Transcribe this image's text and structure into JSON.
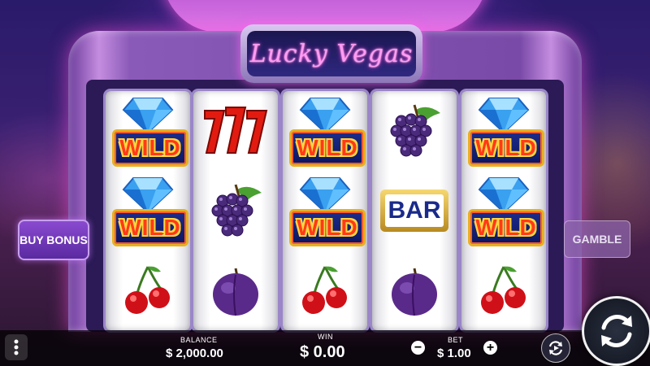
{
  "game": {
    "title": "Lucky Vegas"
  },
  "reels": [
    [
      "wild",
      "wild",
      "cherry"
    ],
    [
      "seven",
      "grapes",
      "plum"
    ],
    [
      "wild",
      "wild",
      "cherry"
    ],
    [
      "grapes",
      "bar",
      "plum"
    ],
    [
      "wild",
      "wild",
      "cherry"
    ]
  ],
  "symbols": {
    "wild_label": "WILD",
    "bar_label": "BAR"
  },
  "buttons": {
    "buy_bonus": "BUY BONUS",
    "gamble": "GAMBLE",
    "bet_minus": "−",
    "bet_plus": "+"
  },
  "stats": {
    "balance_label": "BALANCE",
    "balance_value": "$ 2,000.00",
    "win_label": "WIN",
    "win_value": "$ 0.00",
    "bet_label": "BET",
    "bet_value": "$ 1.00"
  },
  "icons": {
    "menu": "more-vertical-icon",
    "autoplay": "autoplay-icon",
    "spin": "spin-icon"
  },
  "colors": {
    "cabinet": "#c58de0",
    "wild_text": "#ff3a1a",
    "neon_pink": "#ff9cf2"
  }
}
